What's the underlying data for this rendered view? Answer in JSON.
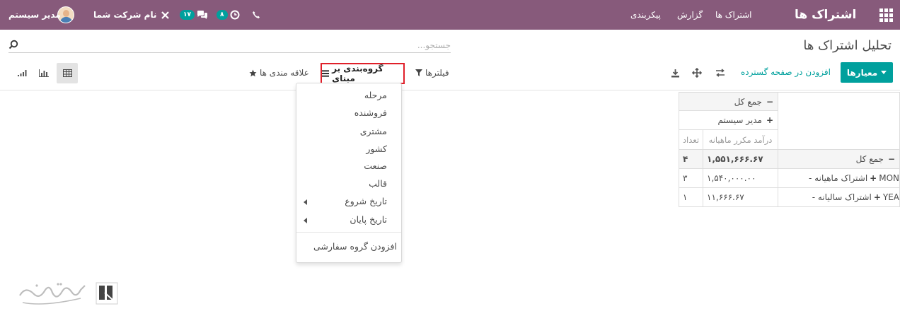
{
  "navbar": {
    "app_title": "اشتراک ها",
    "menu": [
      "اشتراک ها",
      "گزارش",
      "پیکربندی"
    ],
    "company": "نام شرکت شما",
    "user": "مدیر سیستم",
    "messages_count": "۱۷",
    "activities_count": "۸"
  },
  "page": {
    "title": "تحلیل اشتراک ها",
    "search_placeholder": "جستجو..."
  },
  "toolbar": {
    "measures_label": "معیارها",
    "expand_label": "افزودن در صفحه گسترده",
    "filters_label": "فیلترها",
    "groupby_label": "گروه‌بندی بر مبنای",
    "favorites_label": "علاقه مندی ها"
  },
  "groupby_menu": {
    "items": [
      "مرحله",
      "فروشنده",
      "مشتری",
      "کشور",
      "صنعت",
      "قالب",
      "تاریخ شروع",
      "تاریخ پایان"
    ],
    "custom": "افزودن گروه سفارشی"
  },
  "pivot": {
    "col_total": "جمع کل",
    "col_group": "مدیر سیستم",
    "measure_headers": [
      "درآمد مکرر ماهیانه",
      "تعداد"
    ],
    "rows": [
      {
        "label": "جمع کل",
        "code": "",
        "mrr": "۱,۵۵۱,۶۶۶.۶۷",
        "count": "۴"
      },
      {
        "label": "- اشتراک ماهیانه",
        "code": "MON",
        "mrr": "۱,۵۴۰,۰۰۰.۰۰",
        "count": "۳"
      },
      {
        "label": "- اشتراک سالیانه",
        "code": "YEA",
        "mrr": "۱۱,۶۶۶.۶۷",
        "count": "۱"
      }
    ]
  },
  "colors": {
    "navbar": "#875a7b",
    "primary": "#00a09d",
    "highlight": "#e0202a"
  }
}
